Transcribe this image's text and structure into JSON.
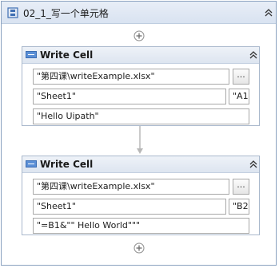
{
  "sequence": {
    "title": "02_1_写一个单元格"
  },
  "activities": [
    {
      "title": "Write Cell",
      "workbook_path": "\"第四课\\writeExample.xlsx\"",
      "browse_label": "...",
      "sheet_name": "\"Sheet1\"",
      "range": "\"A1\"",
      "value": "\"Hello Uipath\""
    },
    {
      "title": "Write Cell",
      "workbook_path": "\"第四课\\writeExample.xlsx\"",
      "browse_label": "...",
      "sheet_name": "\"Sheet1\"",
      "range": "\"B2\"",
      "value": "\"=B1&\"\" Hello World\"\"\""
    }
  ]
}
